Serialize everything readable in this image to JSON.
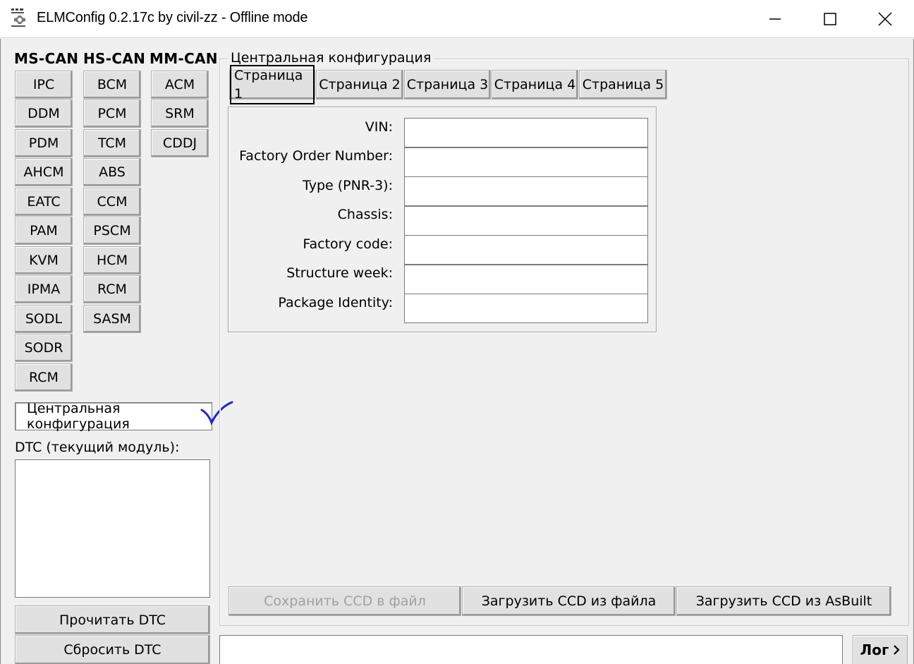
{
  "window": {
    "title": "ELMConfig 0.2.17c by civil-zz - Offline mode",
    "icon_text": "ELM Config"
  },
  "buses": [
    {
      "header": "MS-CAN",
      "modules": [
        "IPC",
        "DDM",
        "PDM",
        "AHCM",
        "EATC",
        "PAM",
        "KVM",
        "IPMA",
        "SODL",
        "SODR",
        "RCM"
      ]
    },
    {
      "header": "HS-CAN",
      "modules": [
        "BCM",
        "PCM",
        "TCM",
        "ABS",
        "CCM",
        "PSCM",
        "HCM",
        "RCM",
        "SASM"
      ]
    },
    {
      "header": "MM-CAN",
      "modules": [
        "ACM",
        "SRM",
        "CDDJ"
      ]
    }
  ],
  "central_config_button": "Центральная конфигурация",
  "dtc": {
    "label": "DTC (текущий модуль):",
    "read_button": "Прочитать DTC",
    "reset_button": "Сбросить DTC"
  },
  "config_group": {
    "title": "Центральная конфигурация",
    "tabs": [
      "Страница 1",
      "Страница 2",
      "Страница 3",
      "Страница 4",
      "Страница 5"
    ],
    "active_tab": 0,
    "fields": [
      {
        "label": "VIN:",
        "value": ""
      },
      {
        "label": "Factory Order Number:",
        "value": ""
      },
      {
        "label": "Type (PNR-3):",
        "value": ""
      },
      {
        "label": "Chassis:",
        "value": ""
      },
      {
        "label": "Factory code:",
        "value": ""
      },
      {
        "label": "Structure week:",
        "value": ""
      },
      {
        "label": "Package Identity:",
        "value": ""
      }
    ],
    "actions": {
      "save_ccd": "Сохранить CCD в файл",
      "load_ccd_file": "Загрузить CCD из файла",
      "load_ccd_asbuilt": "Загрузить CCD из AsBuilt"
    }
  },
  "log": {
    "input_value": "",
    "button_label": "Лог"
  },
  "colors": {
    "face": "#f0f0f0",
    "button": "#e1e1e1",
    "checkmark": "#1a23d6",
    "disabled_text": "#a0a0a0"
  }
}
